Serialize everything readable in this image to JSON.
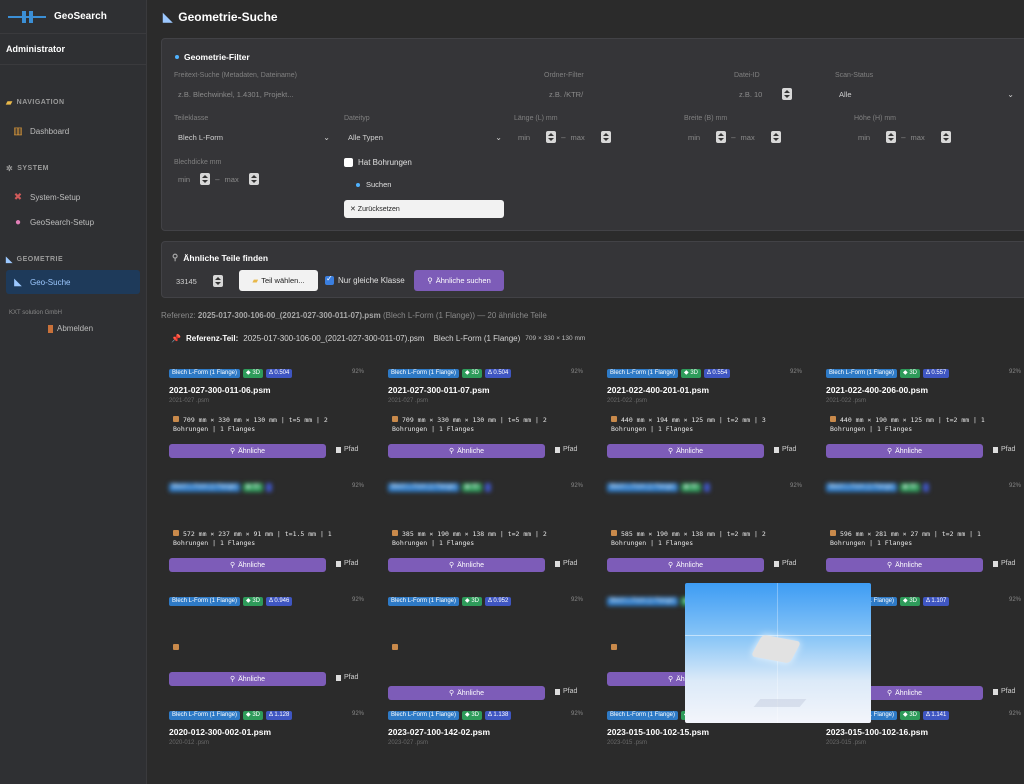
{
  "app": {
    "name": "GeoSearch",
    "user": "Administrator"
  },
  "sidebar": {
    "sections": [
      {
        "label": "NAVIGATION",
        "icon": "folder-icon",
        "items": [
          {
            "label": "Dashboard",
            "icon": "chart-icon"
          }
        ]
      },
      {
        "label": "SYSTEM",
        "icon": "gear-icon",
        "items": [
          {
            "label": "System-Setup",
            "icon": "tools-icon"
          },
          {
            "label": "GeoSearch-Setup",
            "icon": "brain-icon"
          }
        ]
      },
      {
        "label": "GEOMETRIE",
        "icon": "triangle-ruler-icon",
        "items": [
          {
            "label": "Geo-Suche",
            "icon": "triangle-ruler-icon",
            "active": true
          }
        ]
      }
    ],
    "footer": "KXT solution GmbH",
    "logout": "Abmelden"
  },
  "page": {
    "title": "Geometrie-Suche"
  },
  "filter": {
    "title": "Geometrie-Filter",
    "freetext_label": "Freitext-Suche (Metadaten, Dateiname)",
    "freetext_placeholder": "z.B. Blechwinkel, 1.4301, Projekt...",
    "ordner_label": "Ordner-Filter",
    "ordner_placeholder": "z.B. /KTR/",
    "datei_label": "Datei-ID",
    "datei_placeholder": "z.B. 10",
    "scan_label": "Scan-Status",
    "scan_value": "Alle",
    "teil_label": "Teileklasse",
    "teil_value": "Blech L-Form",
    "typ_label": "Dateityp",
    "typ_value": "Alle Typen",
    "laenge_label": "Länge (L) mm",
    "breite_label": "Breite (B) mm",
    "hoehe_label": "Höhe (H) mm",
    "blech_label": "Blechdicke mm",
    "min": "min",
    "max": "max",
    "dash": "–",
    "bohrungen": "Hat Bohrungen",
    "suchen": "Suchen",
    "reset": "✕ Zurücksetzen"
  },
  "similar": {
    "title": "Ähnliche Teile finden",
    "id_value": "33145",
    "choose": "Teil wählen...",
    "same_class": "Nur gleiche Klasse",
    "search": "Ähnliche suchen"
  },
  "reference": {
    "line_prefix": "Referenz:",
    "line_name": "2025-017-300-106-00_(2021-027-300-011-07).psm",
    "line_suffix": "(Blech L-Form (1 Flange)) — 20 ähnliche Teile",
    "label": "Referenz-Teil:",
    "name": "2025-017-300-106-00_(2021-027-300-011-07).psm",
    "class": "Blech L-Form (1 Flange)",
    "size": "709 × 330 × 130 mm"
  },
  "common": {
    "badge_class": "Blech L-Form (1 Flange)",
    "badge_3d": "3D",
    "similar_btn": "Ähnliche",
    "pfad": "Pfad",
    "pct": "92%"
  },
  "results": [
    {
      "score": "Δ 0.504",
      "file": "2021-027-300-011-06.psm",
      "folder": "2021-027 .psm",
      "dims1": "709 mm × 330 mm × 130 mm | t=5 mm | 2",
      "dims2": "Bohrungen | 1 Flanges"
    },
    {
      "score": "Δ 0.504",
      "file": "2021-027-300-011-07.psm",
      "folder": "2021-027 .psm",
      "dims1": "709 mm × 330 mm × 130 mm | t=5 mm | 2",
      "dims2": "Bohrungen | 1 Flanges"
    },
    {
      "score": "Δ 0.554",
      "file": "2021-022-400-201-01.psm",
      "folder": "2021-022 .psm",
      "dims1": "440 mm × 194 mm × 125 mm | t=2 mm | 3",
      "dims2": "Bohrungen | 1 Flanges"
    },
    {
      "score": "Δ 0.557",
      "file": "2021-022-400-206-00.psm",
      "folder": "2021-022 .psm",
      "dims1": "440 mm × 190 mm × 125 mm | t=2 mm | 1",
      "dims2": "Bohrungen | 1 Flanges"
    },
    {
      "score": "",
      "file": "",
      "folder": "",
      "dims1": "572 mm × 237 mm × 91 mm | t=1.5 mm | 1",
      "dims2": "Bohrungen | 1 Flanges"
    },
    {
      "score": "",
      "file": "",
      "folder": "",
      "dims1": "385 mm × 190 mm × 138 mm | t=2 mm | 2",
      "dims2": "Bohrungen | 1 Flanges"
    },
    {
      "score": "",
      "file": "",
      "folder": "",
      "dims1": "585 mm × 190 mm × 138 mm | t=2 mm | 2",
      "dims2": "Bohrungen | 1 Flanges"
    },
    {
      "score": "",
      "file": "",
      "folder": "",
      "dims1": "596 mm × 281 mm × 27 mm | t=2 mm | 1",
      "dims2": "Bohrungen | 1 Flanges"
    },
    {
      "score": "Δ 0.946",
      "file": "",
      "folder": "",
      "dims1": "",
      "dims2": ""
    },
    {
      "score": "Δ 0.952",
      "file": "",
      "folder": "",
      "dims1": "",
      "dims2": ""
    },
    {
      "score": "",
      "file": "",
      "folder": "",
      "dims1": "",
      "dims2": ""
    },
    {
      "score": "Δ 1.107",
      "file": "",
      "folder": "",
      "dims1": "",
      "dims2": ""
    },
    {
      "score": "Δ 1.128",
      "file": "2020-012-300-002-01.psm",
      "folder": "2020-012 .psm"
    },
    {
      "score": "Δ 1.138",
      "file": "2023-027-100-142-02.psm",
      "folder": "2023-027 .psm"
    },
    {
      "score": "Δ 1.138",
      "file": "2023-015-100-102-15.psm",
      "folder": "2023-015 .psm"
    },
    {
      "score": "Δ 1.141",
      "file": "2023-015-100-102-16.psm",
      "folder": "2023-015 .psm"
    }
  ]
}
